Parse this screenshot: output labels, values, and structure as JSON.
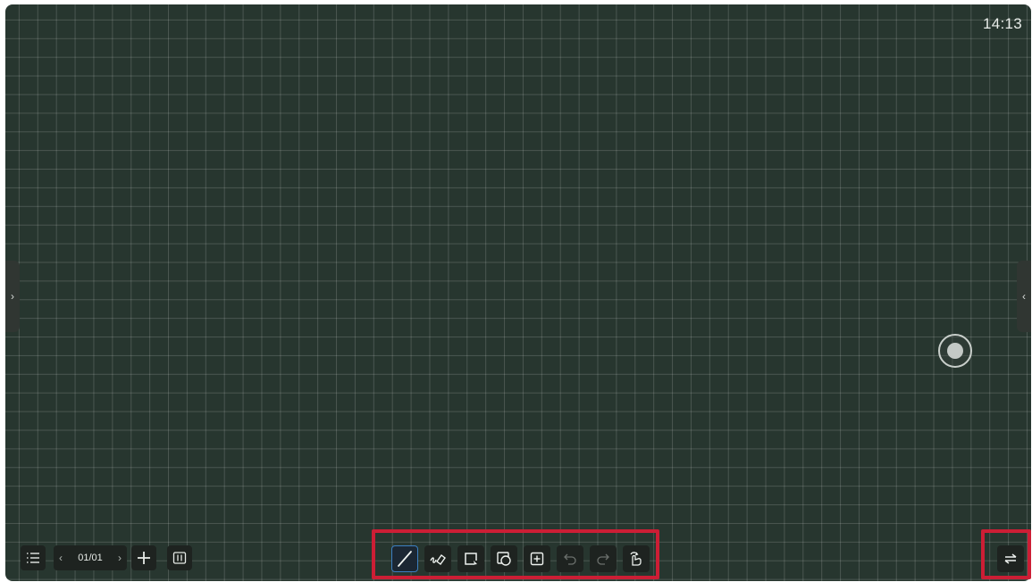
{
  "status": {
    "clock": "14:13"
  },
  "side_tabs": {
    "left_glyph": "›",
    "right_glyph": "‹"
  },
  "bottom_left": {
    "menu_icon": "list-icon",
    "page_prev_glyph": "‹",
    "page_indicator": "01/01",
    "page_next_glyph": "›",
    "add_icon": "plus-icon",
    "page_view_icon": "page-overview-icon"
  },
  "toolbar": {
    "tools": [
      {
        "name": "pen",
        "icon": "pen-icon",
        "active": true
      },
      {
        "name": "eraser",
        "icon": "eraser-icon",
        "active": false
      },
      {
        "name": "select",
        "icon": "lasso-select-icon",
        "active": false
      },
      {
        "name": "shapes",
        "icon": "shapes-icon",
        "active": false
      },
      {
        "name": "insert",
        "icon": "insert-icon",
        "active": false
      },
      {
        "name": "undo",
        "icon": "undo-icon",
        "active": false,
        "disabled": true
      },
      {
        "name": "redo",
        "icon": "redo-icon",
        "active": false,
        "disabled": true
      },
      {
        "name": "gesture",
        "icon": "gesture-icon",
        "active": false
      }
    ]
  },
  "bottom_right": {
    "switch_icon": "switch-toolbar-icon"
  },
  "colors": {
    "board": "#27362f",
    "highlight_frame": "#cc1e35",
    "active_tool_border": "#3c7fc2"
  }
}
